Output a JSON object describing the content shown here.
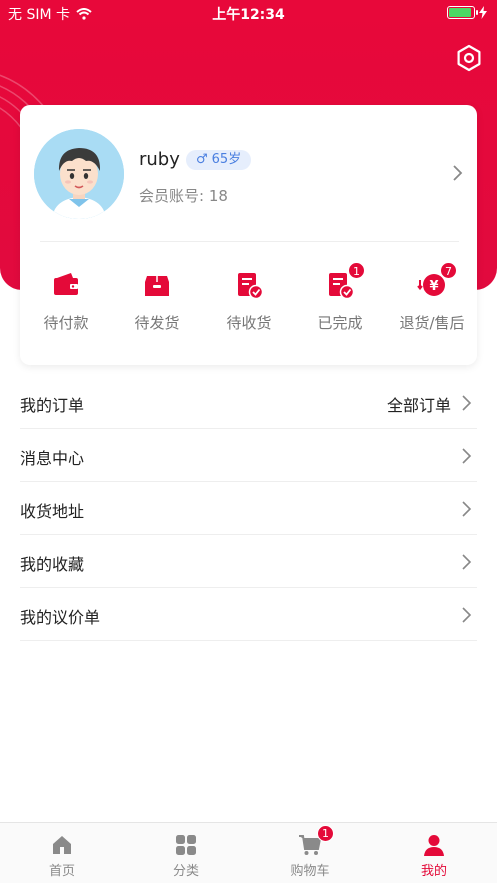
{
  "status_bar": {
    "carrier": "无 SIM 卡",
    "time": "上午12:34",
    "battery_level": 0.9
  },
  "header": {
    "settings_icon": "settings-hexagon-icon"
  },
  "profile": {
    "username": "ruby",
    "gender_symbol": "♂",
    "age": "65岁",
    "member_label": "会员账号:",
    "member_number": "18"
  },
  "order_status": [
    {
      "label": "待付款",
      "icon": "wallet-icon",
      "badge": ""
    },
    {
      "label": "待发货",
      "icon": "package-icon",
      "badge": ""
    },
    {
      "label": "待收货",
      "icon": "receipt-check-icon",
      "badge": ""
    },
    {
      "label": "已完成",
      "icon": "completed-check-icon",
      "badge": "1"
    },
    {
      "label": "退货/售后",
      "icon": "refund-yen-icon",
      "badge": "7"
    }
  ],
  "menu": [
    {
      "label": "我的订单",
      "extra": "全部订单"
    },
    {
      "label": "消息中心",
      "extra": ""
    },
    {
      "label": "收货地址",
      "extra": ""
    },
    {
      "label": "我的收藏",
      "extra": ""
    },
    {
      "label": "我的议价单",
      "extra": ""
    }
  ],
  "tabbar": [
    {
      "label": "首页",
      "icon": "home-icon",
      "badge": "",
      "active": false
    },
    {
      "label": "分类",
      "icon": "category-grid-icon",
      "badge": "",
      "active": false
    },
    {
      "label": "购物车",
      "icon": "cart-icon",
      "badge": "1",
      "active": false
    },
    {
      "label": "我的",
      "icon": "user-icon",
      "badge": "",
      "active": true
    }
  ],
  "colors": {
    "brand": "#e40a39",
    "tag_bg": "#e6eefc",
    "tag_text": "#4a7fe0"
  }
}
